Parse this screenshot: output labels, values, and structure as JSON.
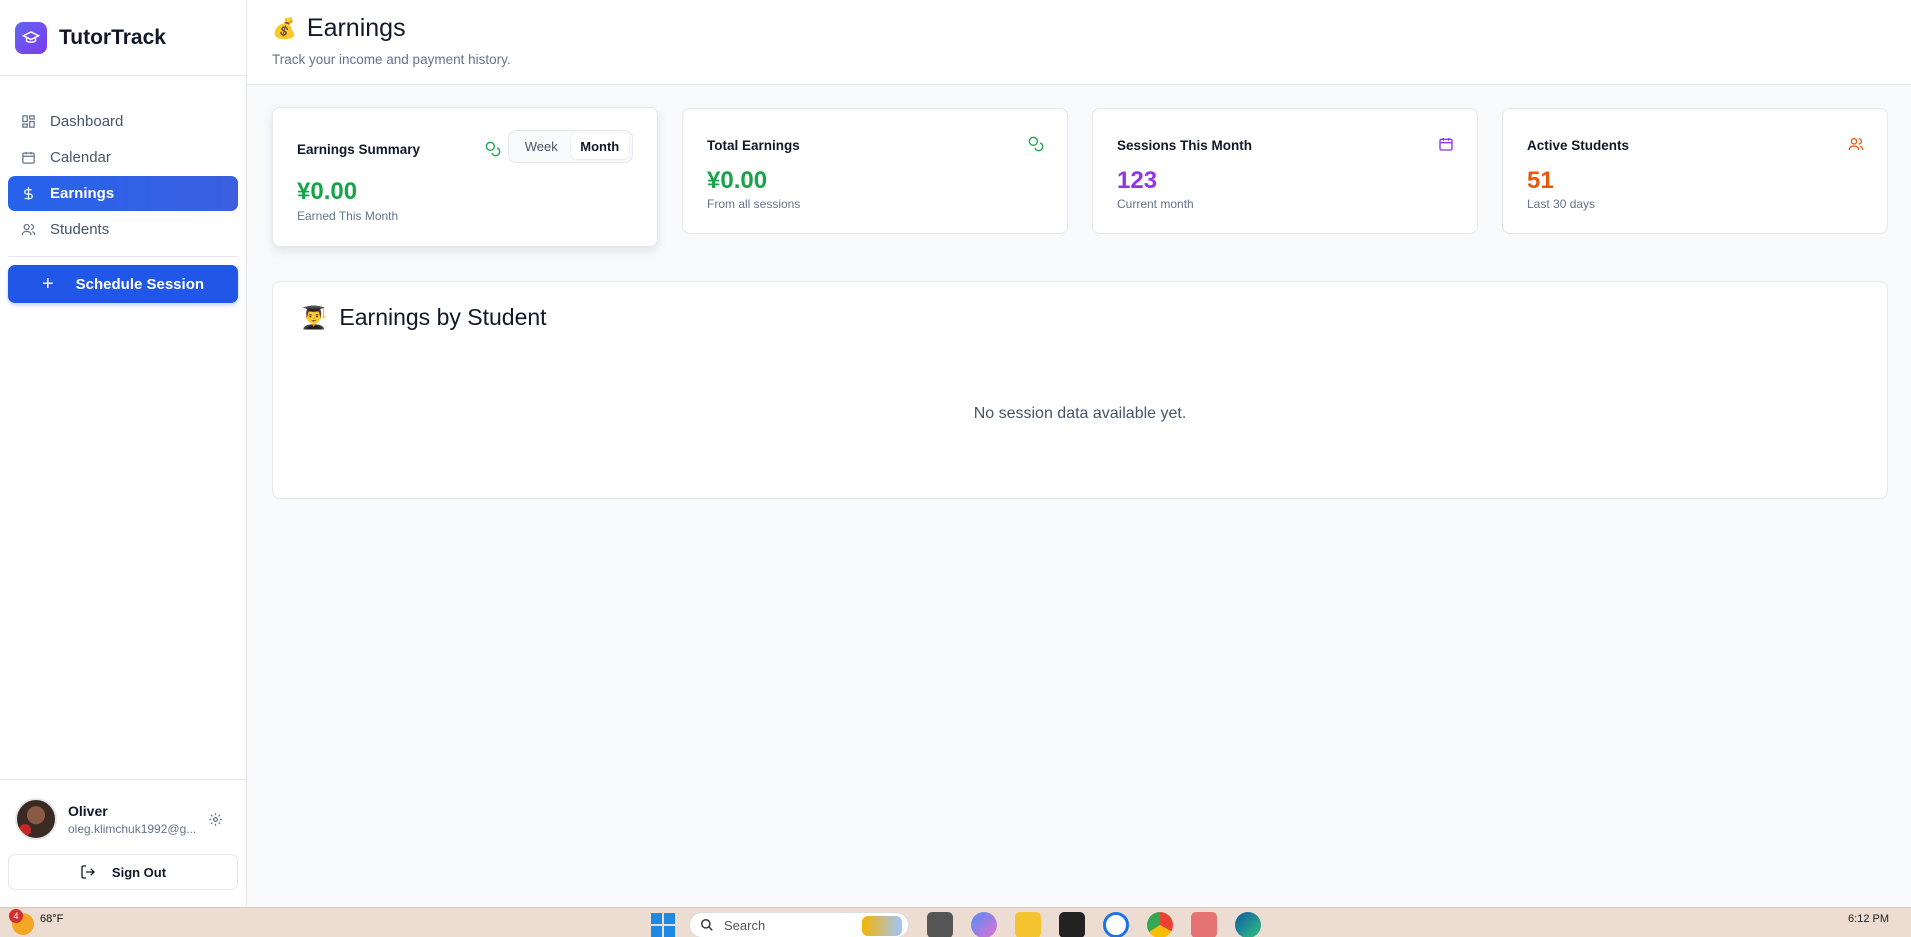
{
  "brand": {
    "name": "TutorTrack"
  },
  "nav": {
    "items": [
      {
        "label": "Dashboard",
        "icon": "grid-icon"
      },
      {
        "label": "Calendar",
        "icon": "calendar-icon"
      },
      {
        "label": "Earnings",
        "icon": "dollar-icon",
        "active": true
      },
      {
        "label": "Students",
        "icon": "users-icon"
      }
    ],
    "schedule_button": "Schedule Session"
  },
  "user": {
    "name": "Oliver",
    "email": "oleg.klimchuk1992@g...",
    "sign_out": "Sign Out"
  },
  "header": {
    "emoji": "💰",
    "title": "Earnings",
    "subtitle": "Track your income and payment history."
  },
  "summary_card": {
    "title": "Earnings Summary",
    "toggle": {
      "week": "Week",
      "month": "Month",
      "selected": "Month"
    },
    "value": "¥0.00",
    "caption": "Earned This Month"
  },
  "stats": [
    {
      "title": "Total Earnings",
      "value": "¥0.00",
      "caption": "From all sessions",
      "color": "#16a34a",
      "icon": "coins-icon"
    },
    {
      "title": "Sessions This Month",
      "value": "123",
      "caption": "Current month",
      "color": "#9333ea",
      "icon": "calendar-icon"
    },
    {
      "title": "Active Students",
      "value": "51",
      "caption": "Last 30 days",
      "color": "#ea580c",
      "icon": "users-icon"
    }
  ],
  "by_student": {
    "emoji": "👨‍🎓",
    "title": "Earnings by Student",
    "empty": "No session data available yet."
  },
  "taskbar": {
    "weather_temp": "68°F",
    "weather_badge": "4",
    "search_placeholder": "Search",
    "time": "6:12 PM"
  },
  "colors": {
    "accent": "#2563eb",
    "green": "#16a34a",
    "purple": "#9333ea",
    "orange": "#ea580c"
  }
}
